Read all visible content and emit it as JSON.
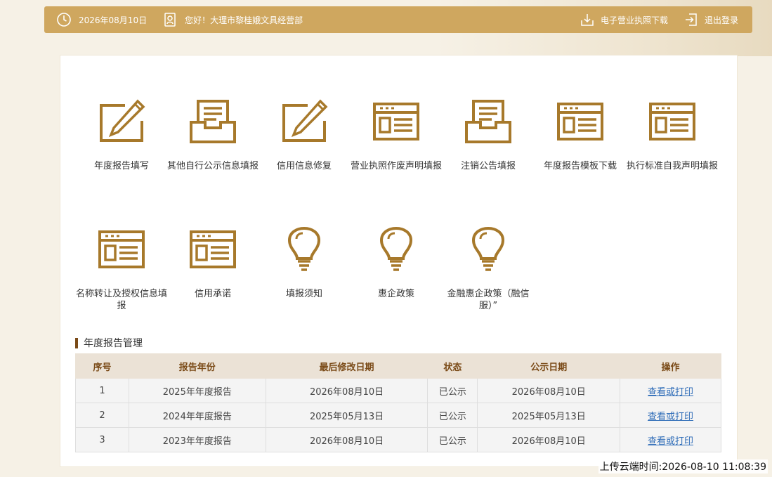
{
  "topbar": {
    "date": "2026年08月10日",
    "greeting": "您好！大理市黎桂娥文具经营部",
    "license_download": "电子营业执照下载",
    "logout": "退出登录",
    "accent_color": "#cfa75f",
    "icons": [
      "clock-icon",
      "user-badge-icon",
      "download-icon",
      "logout-icon"
    ]
  },
  "tiles": [
    {
      "label": "年度报告填写",
      "icon": "pencil-form-icon"
    },
    {
      "label": "其他自行公示信息填报",
      "icon": "document-tray-icon"
    },
    {
      "label": "信用信息修复",
      "icon": "pencil-form-icon"
    },
    {
      "label": "营业执照作废声明填报",
      "icon": "browser-window-icon"
    },
    {
      "label": "注销公告填报",
      "icon": "document-tray-icon"
    },
    {
      "label": "年度报告模板下载",
      "icon": "browser-window-icon"
    },
    {
      "label": "执行标准自我声明填报",
      "icon": "browser-window-icon"
    },
    {
      "label": "名称转让及授权信息填报",
      "icon": "browser-window-icon"
    },
    {
      "label": "信用承诺",
      "icon": "browser-window-icon"
    },
    {
      "label": "填报须知",
      "icon": "lightbulb-icon"
    },
    {
      "label": "惠企政策",
      "icon": "lightbulb-icon"
    },
    {
      "label": "金融惠企政策（融信服）”",
      "icon": "lightbulb-icon"
    }
  ],
  "annual_report": {
    "title": "年度报告管理",
    "headers": [
      "序号",
      "报告年份",
      "最后修改日期",
      "状态",
      "公示日期",
      "操作"
    ],
    "rows": [
      {
        "no": "1",
        "year": "2025年年度报告",
        "modified": "2026年08月10日",
        "status": "已公示",
        "publish": "2026年08月10日",
        "action": "查看或打印"
      },
      {
        "no": "2",
        "year": "2024年年度报告",
        "modified": "2025年05月13日",
        "status": "已公示",
        "publish": "2025年05月13日",
        "action": "查看或打印"
      },
      {
        "no": "3",
        "year": "2023年年度报告",
        "modified": "2026年08月10日",
        "status": "已公示",
        "publish": "2026年08月10日",
        "action": "查看或打印"
      }
    ]
  },
  "upload_time": "上传云端时间:2026-08-10 11:08:39",
  "colors": {
    "icon_gold": "#a7792b",
    "header_text": "#7a4a17",
    "link": "#2f6db8"
  }
}
